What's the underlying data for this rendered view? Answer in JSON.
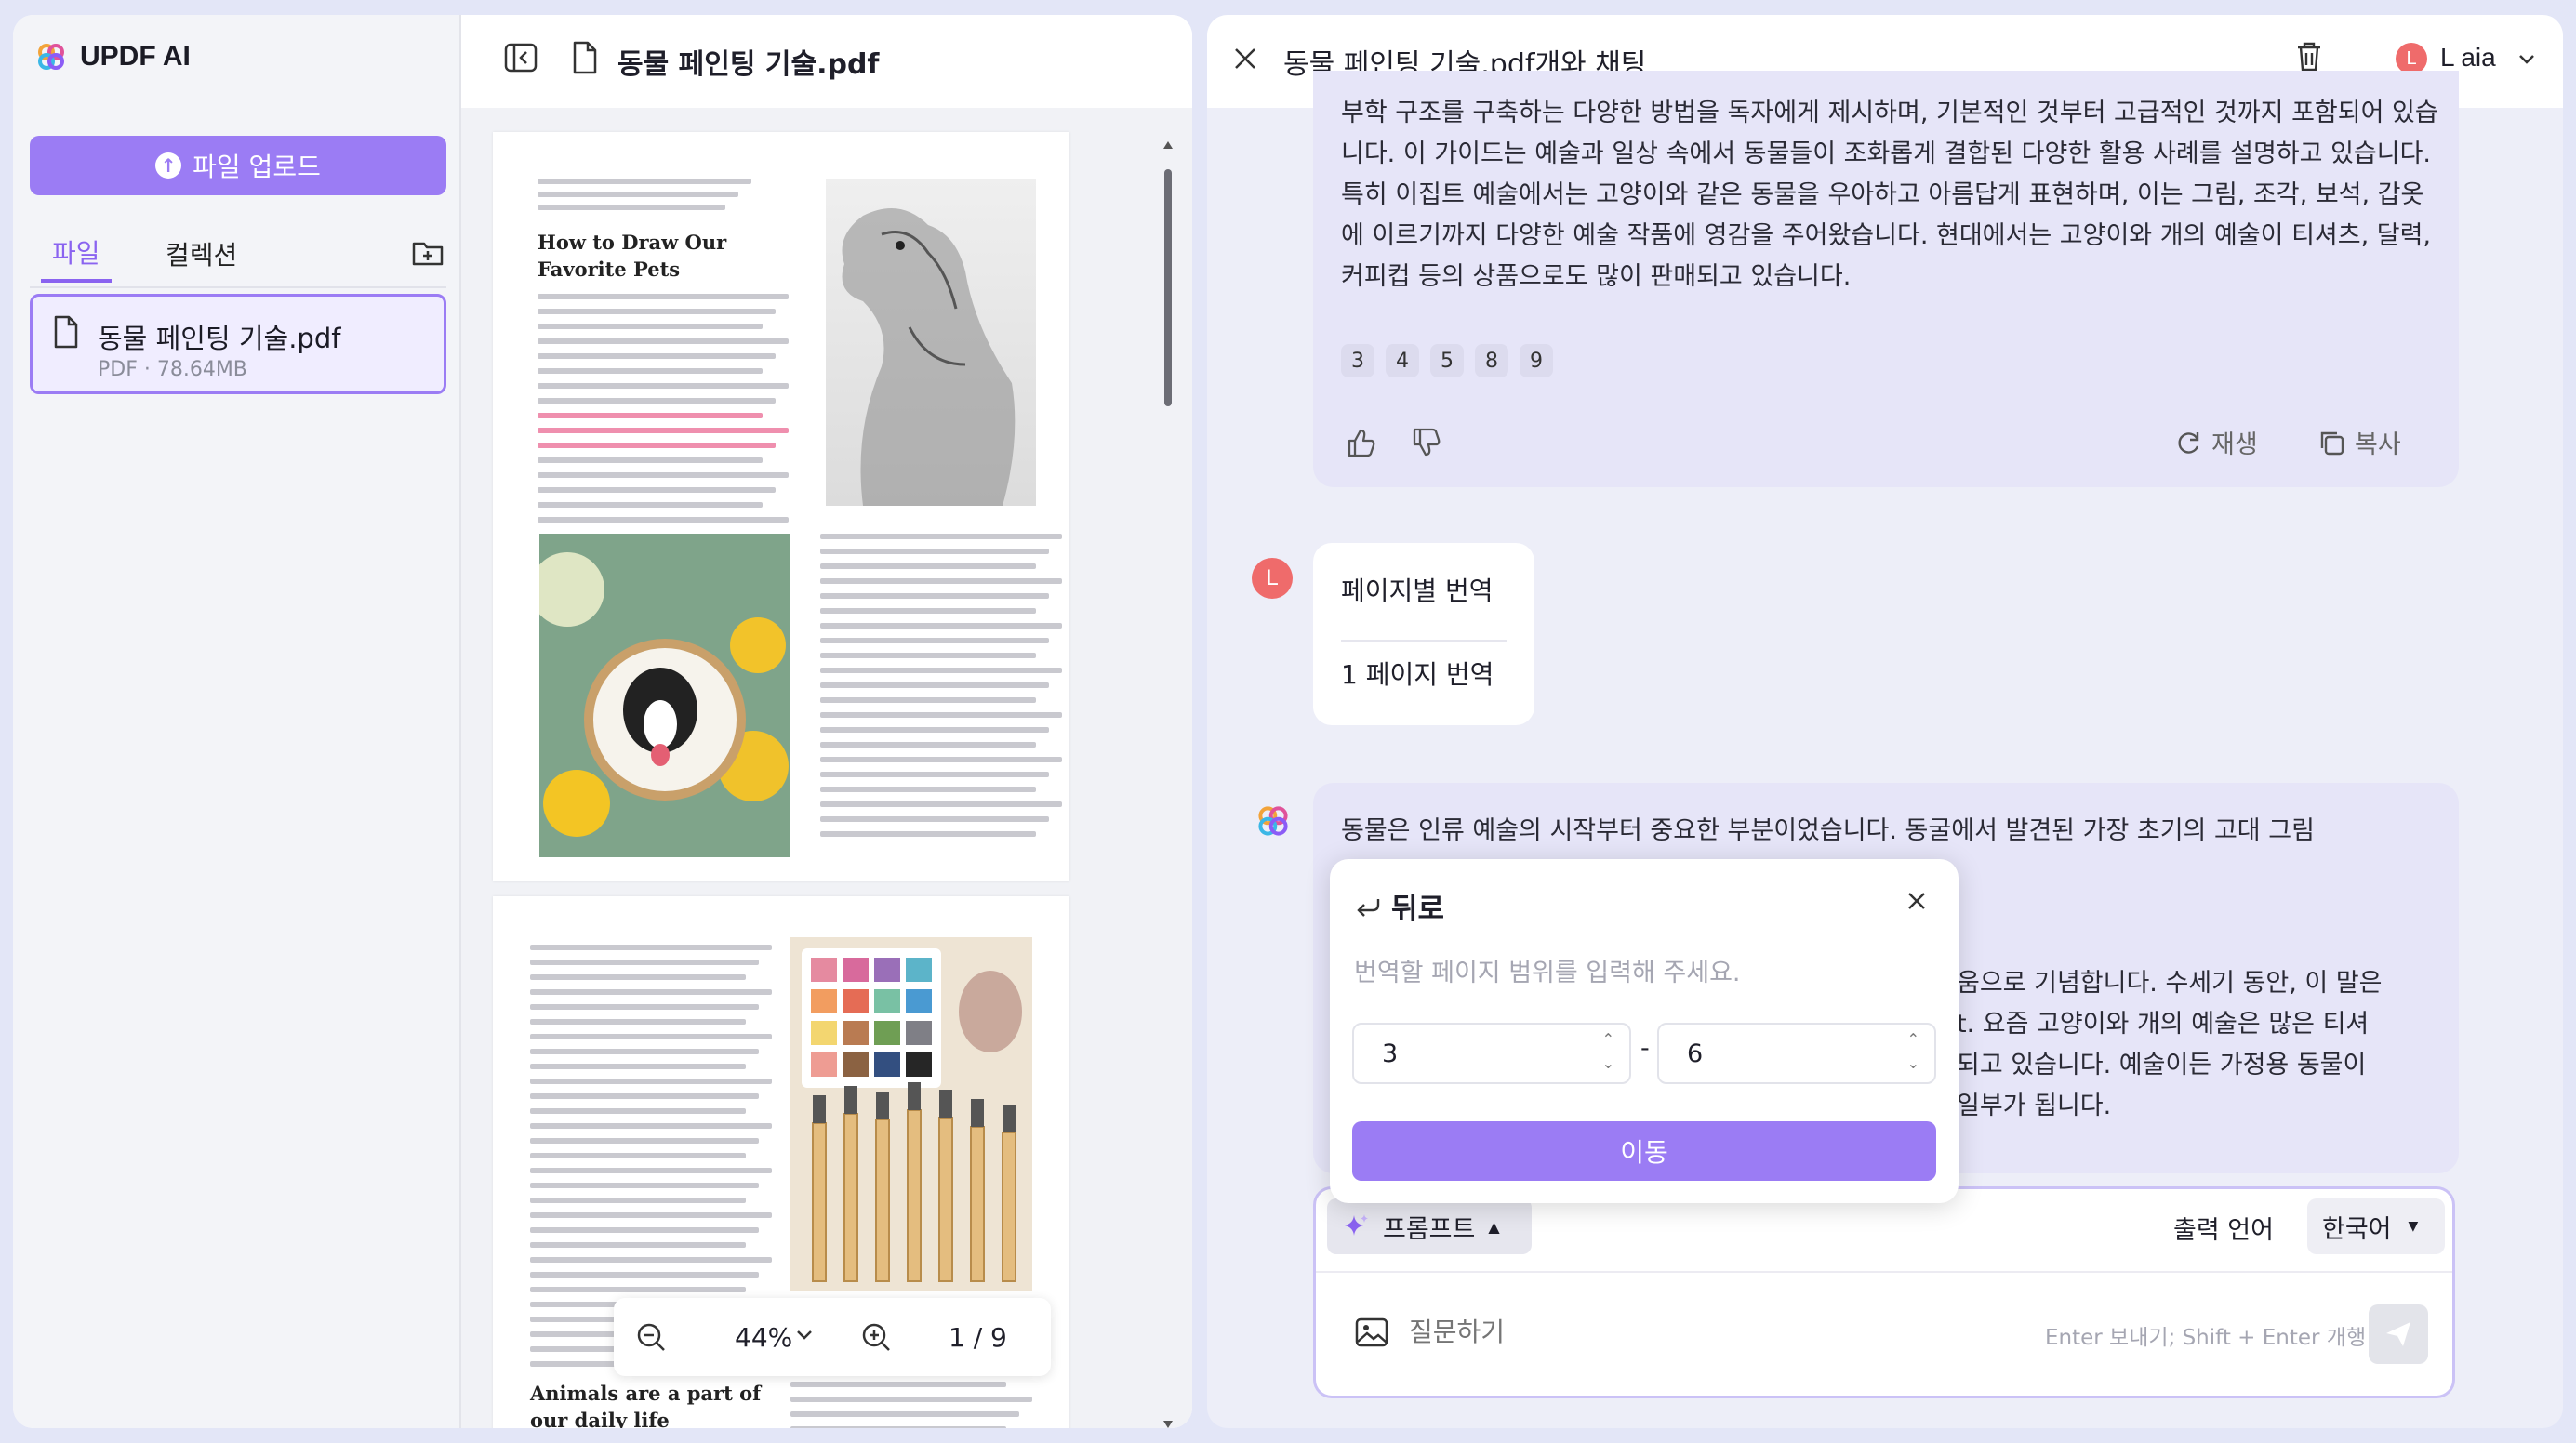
{
  "app": {
    "name": "UPDF AI"
  },
  "sidebar": {
    "upload_label": "파일 업로드",
    "tabs": [
      "파일",
      "컬렉션"
    ],
    "file": {
      "name": "동물 페인팅 기술.pdf",
      "meta": "PDF · 78.64MB"
    }
  },
  "pdf": {
    "title": "동물 페인팅 기술.pdf",
    "page1_heading": "How to Draw Our\nFavorite Pets",
    "page2_heading": "Animals are a part of\nour daily life",
    "zoom": "44%",
    "page_indicator": "1 / 9"
  },
  "chat": {
    "title": "동물 페인팅 기술.pdf개와 채팅",
    "user": "L aia",
    "user_initial": "L",
    "ai_reply_1": "부학 구조를 구축하는 다양한 방법을 독자에게 제시하며, 기본적인 것부터 고급적인 것까지 포함되어 있습니다. 이 가이드는 예술과 일상 속에서 동물들이 조화롭게 결합된 다양한 활용 사례를 설명하고 있습니다. 특히 이집트 예술에서는 고양이와 같은 동물을 우아하고 아름답게 표현하며, 이는 그림, 조각, 보석, 갑옷에 이르기까지 다양한 예술 작품에 영감을 주어왔습니다. 현대에서는 고양이와 개의 예술이 티셔츠, 달력, 커피컵 등의 상품으로도 많이 판매되고 있습니다.",
    "page_refs": [
      "3",
      "4",
      "5",
      "8",
      "9"
    ],
    "regenerate_label": "재생",
    "copy_label": "복사",
    "user_msg_title": "페이지별 번역",
    "user_msg_body": "1 페이지 번역",
    "ai_reply_2_line1": "동물은 인류 예술의 시작부터 중요한 부분이었습니다. 동굴에서 발견된 가장 초기의 고대 그림",
    "ai_reply_2_line3": "움으로 기념합니다. 수세기 동안, 이 말은",
    "ai_reply_2_line4": "t. 요즘 고양이와 개의 예술은 많은 티셔",
    "ai_reply_2_line5": "되고 있습니다. 예술이든 가정용 동물이",
    "ai_reply_2_line6": "일부가 됩니다."
  },
  "popup": {
    "back_label": "뒤로",
    "hint": "번역할 페이지 범위를 입력해 주세요.",
    "from": "3",
    "to": "6",
    "dash": "-",
    "go_label": "이동"
  },
  "composer": {
    "prompt_label": "프롬프트",
    "output_lang_label": "출력 언어",
    "output_lang_value": "한국어",
    "placeholder": "질문하기",
    "hint": "Enter 보내기; Shift + Enter 개행"
  },
  "colors": {
    "accent": "#9b7cf4",
    "avatar": "#ef6b6b",
    "bubble": "#e6e5f8"
  }
}
